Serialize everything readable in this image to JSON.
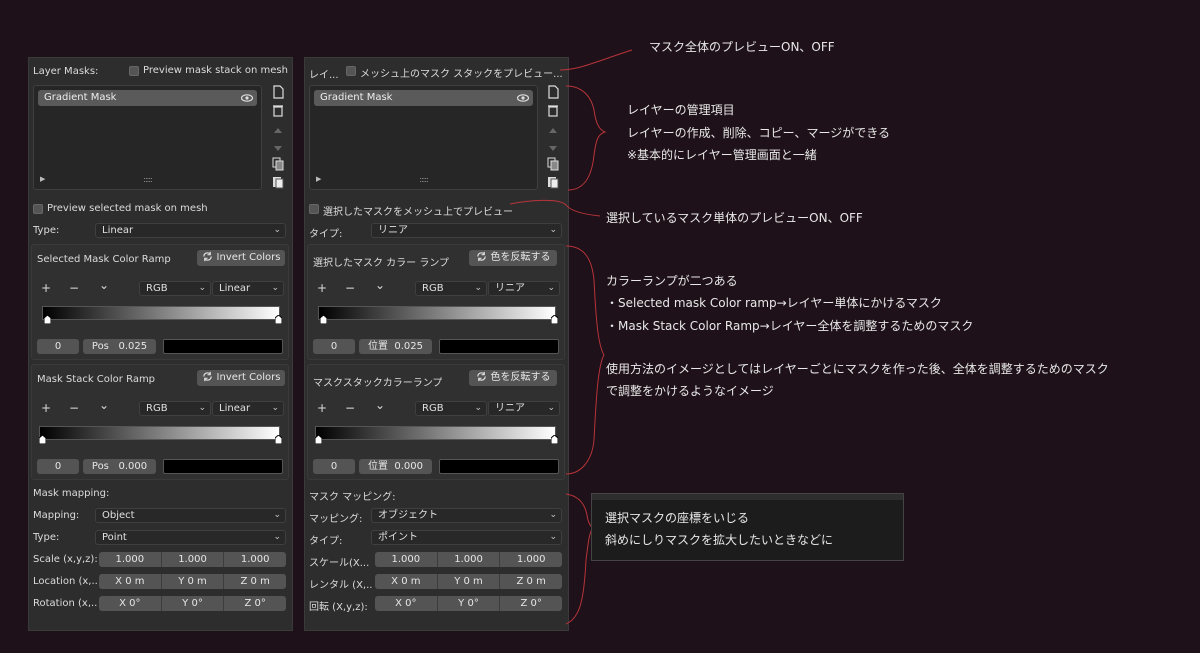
{
  "left_panel": {
    "layer_masks_label": "Layer Masks:",
    "preview_stack_label": "Preview mask stack on mesh",
    "mask_item": "Gradient Mask",
    "preview_selected_label": "Preview selected mask on mesh",
    "type_label": "Type:",
    "type_value": "Linear",
    "selected_ramp_title": "Selected Mask Color Ramp",
    "invert_colors": "Invert Colors",
    "plus": "+",
    "minus": "−",
    "chevron": "⌄",
    "rgb": "RGB",
    "interp": "Linear",
    "stop_index": "0",
    "pos_label": "Pos",
    "pos_value_1": "0.025",
    "stack_ramp_title": "Mask Stack Color Ramp",
    "pos_value_2": "0.000",
    "mask_mapping": "Mask mapping:",
    "mapping_label": "Mapping:",
    "mapping_value": "Object",
    "map_type_label": "Type:",
    "map_type_value": "Point",
    "scale_label": "Scale (x,y,z):",
    "location_label": "Location (x,...",
    "rotation_label": "Rotation (x,...",
    "scale_vals": [
      "1.000",
      "1.000",
      "1.000"
    ],
    "loc_vals": [
      "X     0 m",
      "Y     0 m",
      "Z     0 m"
    ],
    "rot_vals": [
      "X      0°",
      "Y      0°",
      "Z      0°"
    ]
  },
  "right_panel": {
    "layer_masks_label": "レイ...",
    "preview_stack_label": "メッシュ上のマスク スタックをプレビュー...",
    "mask_item": "Gradient Mask",
    "preview_selected_label": "選択したマスクをメッシュ上でプレビュー",
    "type_label": "タイプ:",
    "type_value": "リニア",
    "selected_ramp_title": "選択したマスク カラー ランプ",
    "invert_colors": "色を反転する",
    "plus": "+",
    "minus": "−",
    "chevron": "⌄",
    "rgb": "RGB",
    "interp": "リニア",
    "stop_index": "0",
    "pos_label": "位置",
    "pos_value_1": "0.025",
    "stack_ramp_title": "マスクスタックカラーランプ",
    "pos_value_2": "0.000",
    "mask_mapping": "マスク マッピング:",
    "mapping_label": "マッピング:",
    "mapping_value": "オブジェクト",
    "map_type_label": "タイプ:",
    "map_type_value": "ポイント",
    "scale_label": "スケール(X...",
    "location_label": "レンタル (X,...",
    "rotation_label": "回転 (X,y,z):",
    "scale_vals": [
      "1.000",
      "1.000",
      "1.000"
    ],
    "loc_vals": [
      "X     0 m",
      "Y     0 m",
      "Z     0 m"
    ],
    "rot_vals": [
      "X      0°",
      "Y      0°",
      "Z      0°"
    ]
  },
  "notes": {
    "n1": "マスク全体のプレビューON、OFF",
    "n2a": "レイヤーの管理項目",
    "n2b": "レイヤーの作成、削除、コピー、マージができる",
    "n2c": "※基本的にレイヤー管理画面と一緒",
    "n3": "選択しているマスク単体のプレビューON、OFF",
    "n4a": "カラーランプが二つある",
    "n4b": "・Selected mask Color ramp→レイヤー単体にかけるマスク",
    "n4c": "・Mask Stack Color Ramp→レイヤー全体を調整するためのマスク",
    "n4d": "使用方法のイメージとしてはレイヤーごとにマスクを作った後、全体を調整するためのマスク",
    "n4e": "で調整をかけるようなイメージ",
    "n5a": "選択マスクの座標をいじる",
    "n5b": "斜めにしりマスクを拡大したいときなどに"
  },
  "colors": {
    "background": "#1e1119",
    "panel": "#2d2d2d",
    "annotation_line": "#b8343a"
  }
}
